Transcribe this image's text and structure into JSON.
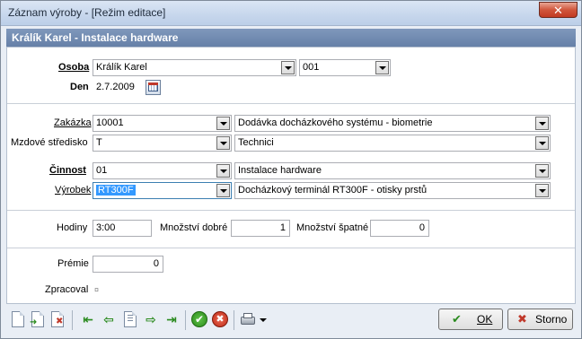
{
  "window": {
    "title": "Záznam výroby - [Režim editace]",
    "close_glyph": "✕"
  },
  "header": {
    "title": "Králík Karel  -  Instalace hardware"
  },
  "form": {
    "osoba": {
      "label": "Osoba",
      "name_value": "Králík Karel",
      "code_value": "001"
    },
    "den": {
      "label": "Den",
      "value": "2.7.2009"
    },
    "zakazka": {
      "label": "Zakázka",
      "code_value": "10001",
      "desc_value": "Dodávka docházkového systému - biometrie"
    },
    "stredisko": {
      "label": "Mzdové středisko",
      "code_value": "T",
      "desc_value": "Technici"
    },
    "cinnost": {
      "label": "Činnost",
      "code_value": "01",
      "desc_value": "Instalace hardware"
    },
    "vyrobek": {
      "label": "Výrobek",
      "code_value": "RT300F",
      "desc_value": "Docházkový terminál RT300F - otisky prstů"
    },
    "hodiny": {
      "label": "Hodiny",
      "value": "3:00"
    },
    "mnozstvi_dobre": {
      "label": "Množství dobré",
      "value": "1"
    },
    "mnozstvi_spatne": {
      "label": "Množství špatné",
      "value": "0"
    },
    "premie": {
      "label": "Prémie",
      "value": "0"
    },
    "zpracoval": {
      "label": "Zpracoval",
      "value": "¤"
    }
  },
  "toolbar": {
    "icons": [
      "new-record-icon",
      "copy-record-icon",
      "delete-record-icon",
      "first-record-icon",
      "previous-record-icon",
      "find-record-icon",
      "next-record-icon",
      "last-record-icon",
      "confirm-icon",
      "cancel-icon",
      "print-icon"
    ]
  },
  "buttons": {
    "ok": {
      "label": "OK",
      "icon_glyph": "✔"
    },
    "storno": {
      "label": "Storno",
      "icon_glyph": "✖"
    }
  },
  "colors": {
    "header_band": "#6f89b0",
    "selection": "#3399ff",
    "ok_green": "#2a8a1e",
    "storno_red": "#c0392b"
  }
}
